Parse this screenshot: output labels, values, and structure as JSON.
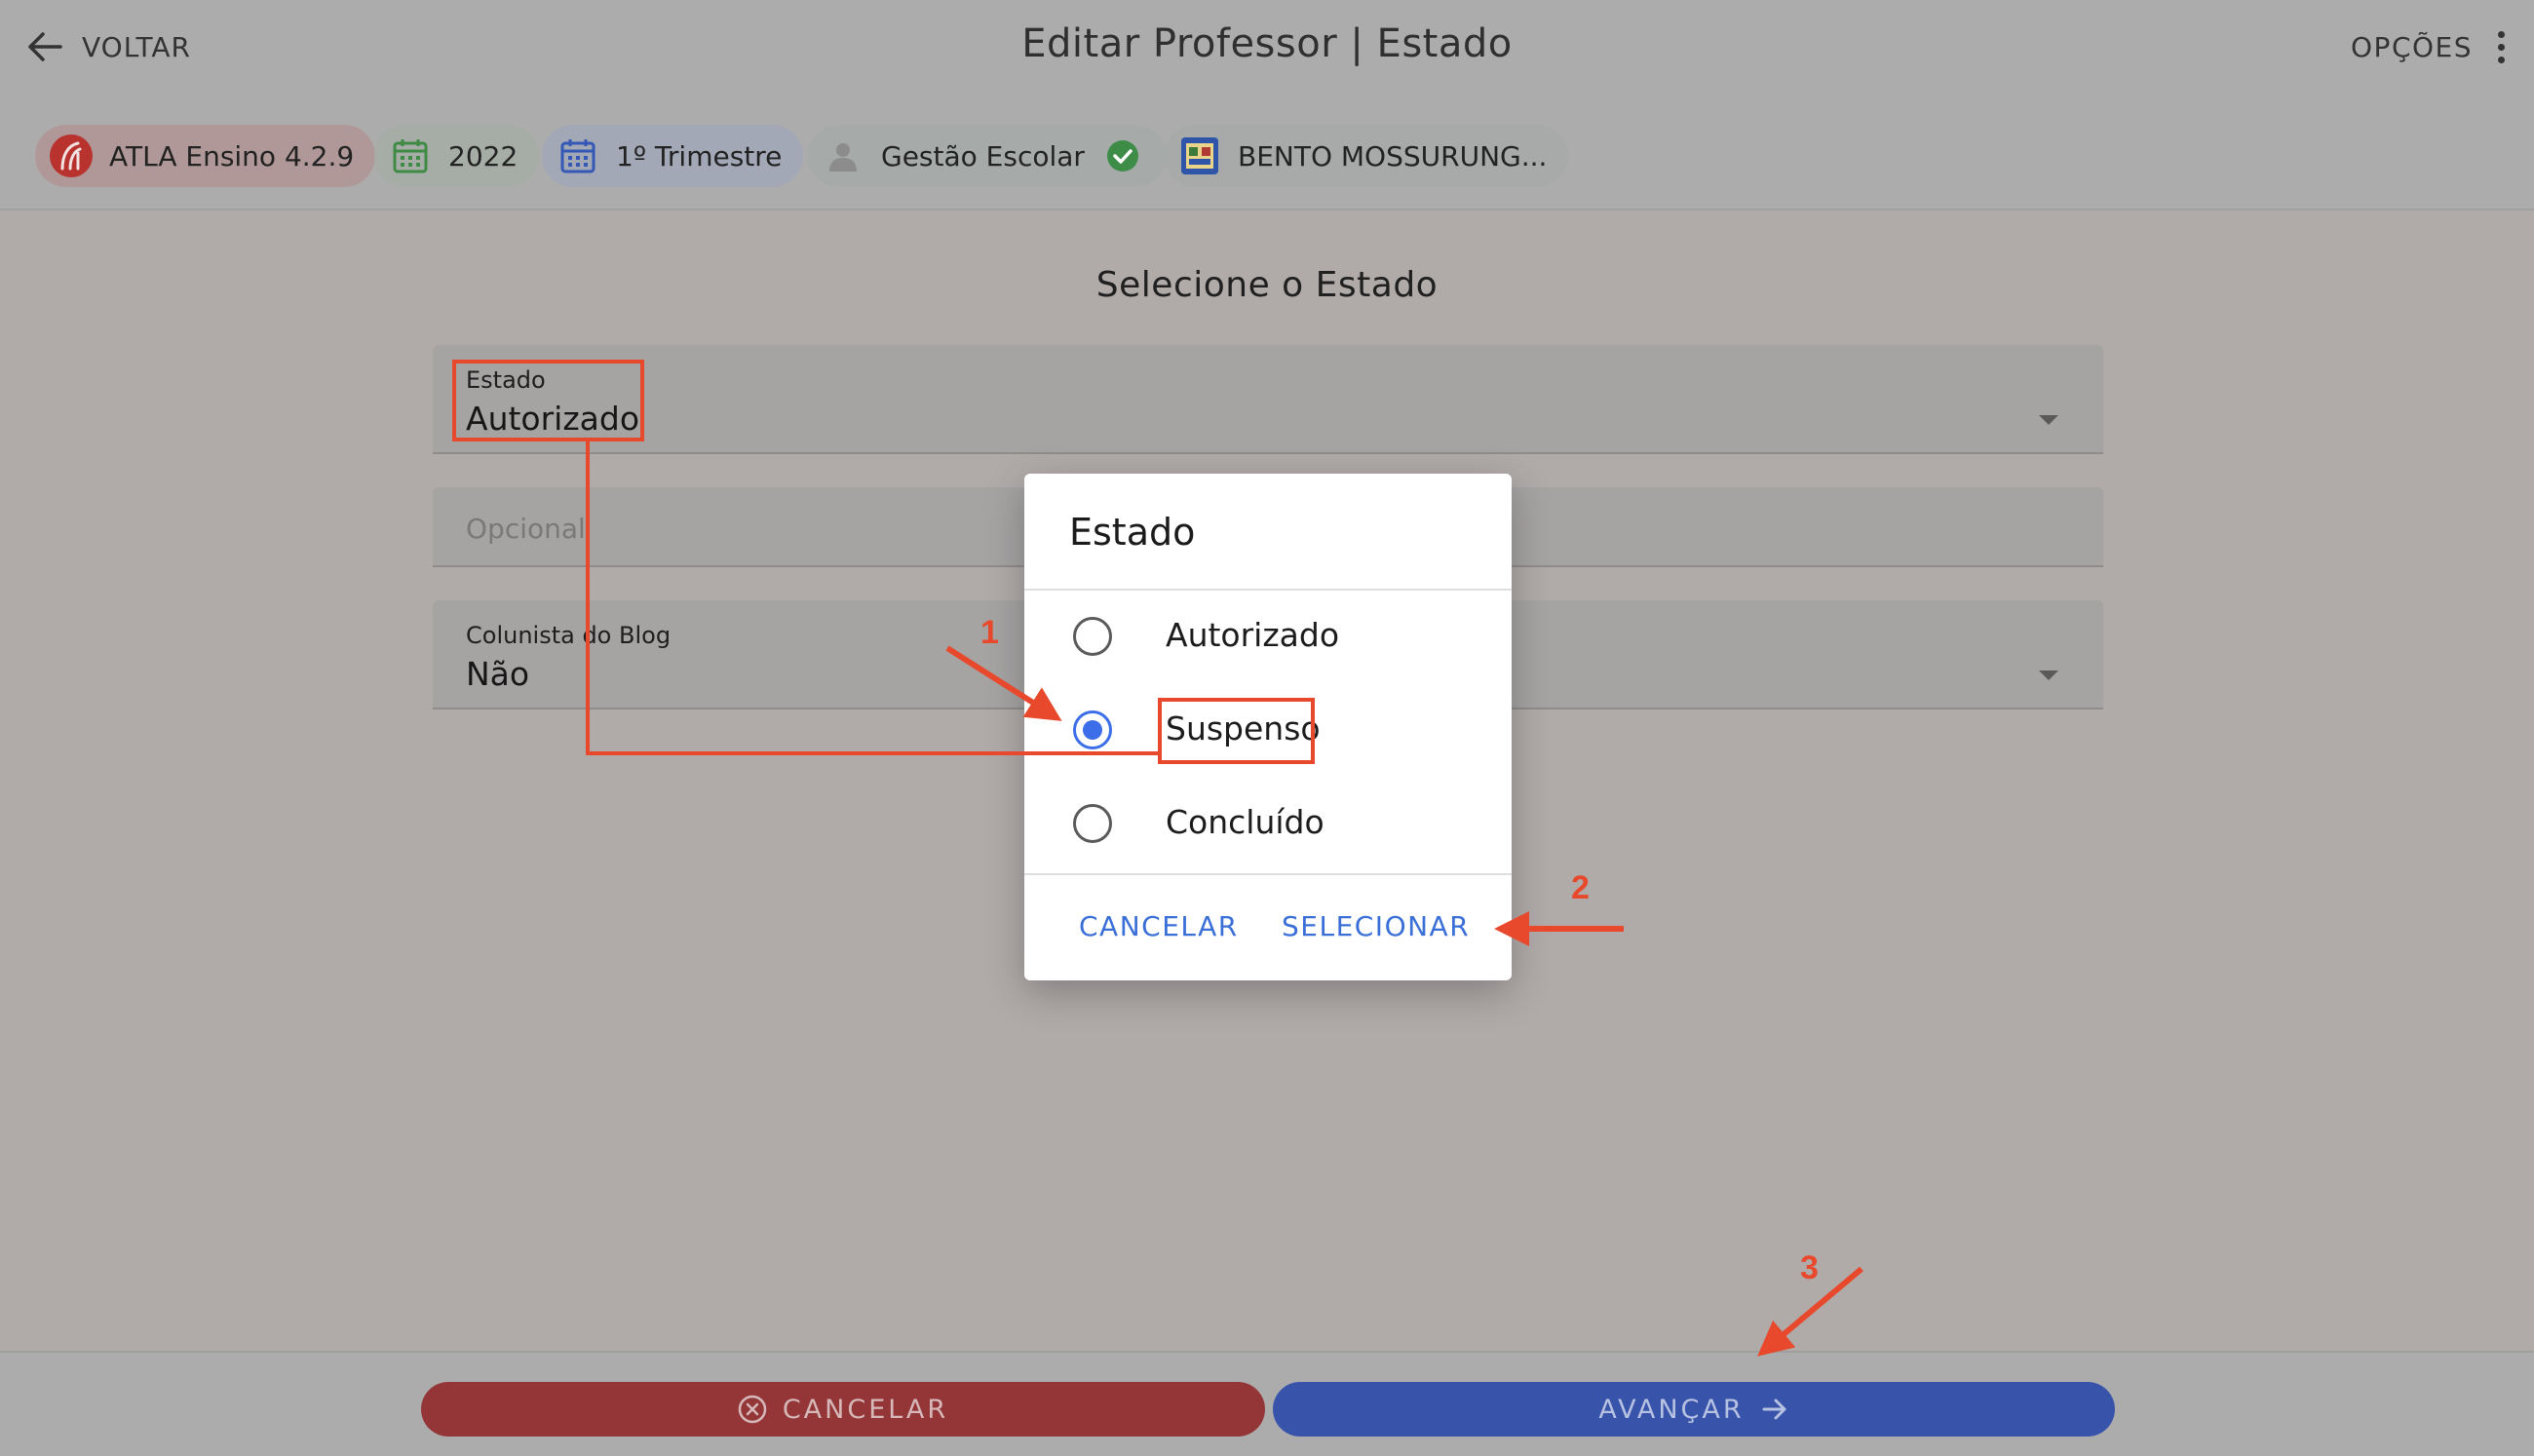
{
  "header": {
    "back_label": "VOLTAR",
    "title": "Editar Professor | Estado",
    "options_label": "OPÇÕES"
  },
  "chips": [
    {
      "label": "ATLA Ensino 4.2.9",
      "icon": "atla-logo-icon",
      "bg": "#b19898"
    },
    {
      "label": "2022",
      "icon": "calendar-green-icon",
      "bg": "#a6aca6"
    },
    {
      "label": "1º Trimestre",
      "icon": "calendar-blue-icon",
      "bg": "#a3a8b7"
    },
    {
      "label": "Gestão Escolar",
      "icon": "person-icon",
      "status_icon": "check-circle-icon",
      "bg": "#a6aaa9"
    },
    {
      "label": "BENTO MOSSURUNG...",
      "icon": "school-badge-icon",
      "bg": "#a7aaa9"
    }
  ],
  "form": {
    "section_title": "Selecione o Estado",
    "estado": {
      "label": "Estado",
      "value": "Autorizado"
    },
    "opcional": {
      "placeholder": "Opcional"
    },
    "colunista": {
      "label": "Colunista do Blog",
      "value": "Não"
    }
  },
  "dialog": {
    "title": "Estado",
    "options": [
      {
        "label": "Autorizado",
        "selected": false
      },
      {
        "label": "Suspenso",
        "selected": true
      },
      {
        "label": "Concluído",
        "selected": false
      }
    ],
    "cancel_label": "CANCELAR",
    "select_label": "SELECIONAR"
  },
  "footer": {
    "cancel_label": "CANCELAR",
    "next_label": "AVANÇAR"
  },
  "annotations": {
    "step1": "1",
    "step2": "2",
    "step3": "3",
    "color": "#e8492c"
  },
  "colors": {
    "accent_blue": "#3b6ee8",
    "cancel_red": "#943538",
    "next_blue": "#3853aa"
  }
}
